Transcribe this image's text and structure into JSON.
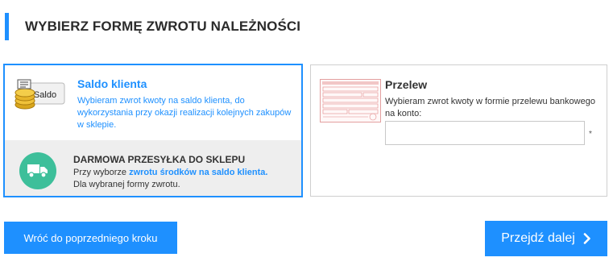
{
  "header": {
    "title": "WYBIERZ FORMĘ ZWROTU NALEŻNOŚCI"
  },
  "saldo": {
    "icon_label": "Saldo",
    "title": "Saldo klienta",
    "description": "Wybieram zwrot kwoty na saldo klienta, do wykorzystania przy okazji realizacji kolejnych zakupów w sklepie.",
    "shipping": {
      "title": "DARMOWA PRZESYŁKA DO SKLEPU",
      "line1_prefix": "Przy wyborze ",
      "line1_link": "zwrotu środków na saldo klienta.",
      "line2": "Dla wybranej formy zwrotu."
    }
  },
  "przelew": {
    "title": "Przelew",
    "description": "Wybieram zwrot kwoty w formie przelewu bankowego na konto:",
    "account_value": "",
    "required_mark": "*"
  },
  "buttons": {
    "back_label": "Wróć do poprzedniego kroku",
    "next_label": "Przejdź dalej"
  },
  "colors": {
    "accent": "#1e90ff",
    "truck_circle": "#3dbf9a",
    "shipping_bg": "#eeeeee"
  },
  "icons": {
    "saldo": "coins-saldo-icon",
    "truck": "truck-icon",
    "transfer_form": "transfer-form-icon",
    "next": "chevron-right-icon"
  }
}
